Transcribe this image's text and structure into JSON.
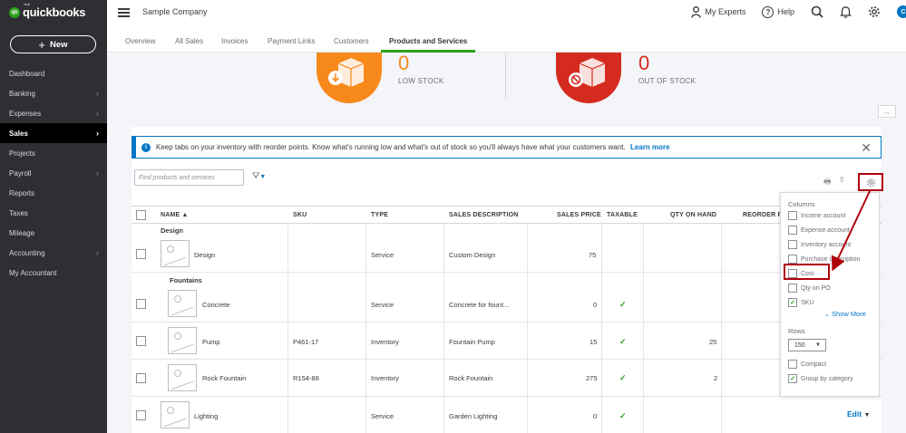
{
  "brand": {
    "logo_small": "intuit",
    "logo_name": "quickbooks",
    "logo_mark": "qb"
  },
  "sidebar": {
    "new_label": "New",
    "items": [
      {
        "label": "Dashboard",
        "chevron": false
      },
      {
        "label": "Banking",
        "chevron": true
      },
      {
        "label": "Expenses",
        "chevron": true
      },
      {
        "label": "Sales",
        "chevron": true,
        "active": true
      },
      {
        "label": "Projects",
        "chevron": false
      },
      {
        "label": "Payroll",
        "chevron": true
      },
      {
        "label": "Reports",
        "chevron": false
      },
      {
        "label": "Taxes",
        "chevron": false
      },
      {
        "label": "Mileage",
        "chevron": false
      },
      {
        "label": "Accounting",
        "chevron": true
      },
      {
        "label": "My Accountant",
        "chevron": false
      }
    ]
  },
  "header": {
    "company": "Sample Company",
    "my_experts": "My Experts",
    "help": "Help",
    "avatar_initial": "C"
  },
  "tabs": [
    "Overview",
    "All Sales",
    "Invoices",
    "Payment Links",
    "Customers",
    "Products and Services"
  ],
  "active_tab": "Products and Services",
  "stock": {
    "low": {
      "count": "0",
      "label": "LOW STOCK",
      "color": "#f7891b"
    },
    "out": {
      "count": "0",
      "label": "OUT OF STOCK",
      "color": "#d52b1e"
    }
  },
  "info_banner": {
    "text": "Keep tabs on your inventory with reorder points. Know what's running low and what's out of stock so you'll always have what your customers want.",
    "link": "Learn more"
  },
  "search": {
    "placeholder": "Find products and services"
  },
  "table": {
    "headers": {
      "name": "NAME ▲",
      "sku": "SKU",
      "type": "TYPE",
      "sales_description": "SALES DESCRIPTION",
      "sales_price": "SALES PRICE",
      "taxable": "TAXABLE",
      "qty_on_hand": "QTY ON HAND",
      "reorder_point": "REORDER P"
    },
    "groups": {
      "design": "Design",
      "fountains": "Fountains"
    },
    "rows": [
      {
        "name": "Design",
        "sku": "",
        "type": "Service",
        "desc": "Custom Design",
        "price": "75",
        "taxable": false,
        "qty": ""
      },
      {
        "name": "Concrete",
        "sku": "",
        "type": "Service",
        "desc": "Concrete for fount...",
        "price": "0",
        "taxable": true,
        "qty": ""
      },
      {
        "name": "Pump",
        "sku": "P461-17",
        "type": "Inventory",
        "desc": "Fountain Pump",
        "price": "15",
        "taxable": true,
        "qty": "25"
      },
      {
        "name": "Rock Fountain",
        "sku": "R154-88",
        "type": "Inventory",
        "desc": "Rock Fountain",
        "price": "275",
        "taxable": true,
        "qty": "2"
      },
      {
        "name": "Lighting",
        "sku": "",
        "type": "Service",
        "desc": "Garden Lighting",
        "price": "0",
        "taxable": true,
        "qty": ""
      }
    ],
    "edit_label": "Edit"
  },
  "column_settings": {
    "columns_heading": "Columns",
    "options": [
      {
        "label": "Income account",
        "checked": false
      },
      {
        "label": "Expense account",
        "checked": false
      },
      {
        "label": "Inventory account",
        "checked": false
      },
      {
        "label": "Purchase description",
        "checked": false
      },
      {
        "label": "Cost",
        "checked": false
      },
      {
        "label": "Qty on PO",
        "checked": false
      },
      {
        "label": "SKU",
        "checked": true
      }
    ],
    "show_more": "Show More",
    "rows_heading": "Rows",
    "rows_value": "150",
    "compact": {
      "label": "Compact",
      "checked": false
    },
    "group_by_category": {
      "label": "Group by category",
      "checked": true
    }
  },
  "colors": {
    "accent_green": "#2ca01c",
    "link_blue": "#0077c5",
    "highlight_red": "#b0000a"
  }
}
